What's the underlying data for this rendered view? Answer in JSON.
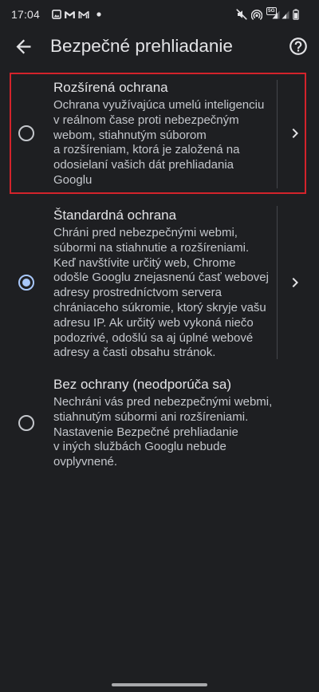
{
  "status_bar": {
    "time": "17:04",
    "network_type": "5G",
    "notification_icons": [
      "image-icon",
      "gmail-icon",
      "gmail-outline-icon",
      "dot-icon"
    ],
    "system_icons": [
      "mute-icon",
      "hotspot-icon",
      "signal-5g-icon",
      "signal-icon",
      "battery-icon"
    ]
  },
  "header": {
    "back_icon": "arrow-back-icon",
    "title": "Bezpečné prehliadanie",
    "help_icon": "help-icon"
  },
  "options": [
    {
      "title": "Rozšírená ochrana",
      "description": "Ochrana využívajúca umelú inteligenciu\nv reálnom čase proti nebezpečným\nwebom, stiahnutým súborom\na rozšíreniam, ktorá je založená na\nodosielaní vašich dát prehliadania\nGooglu",
      "selected": false,
      "details_icon": "chevron-right-icon"
    },
    {
      "title": "Štandardná ochrana",
      "description": "Chráni pred nebezpečnými webmi,\nsúbormi na stiahnutie a rozšíreniami.\nKeď navštívite určitý web, Chrome\nodošle Googlu znejasnenú časť webovej\nadresy prostredníctvom servera\nchrániaceho súkromie, ktorý skryje vašu\nadresu IP. Ak určitý web vykoná niečo\npodozrivé, odošlú sa aj úplné webové\nadresy a časti obsahu stránok.",
      "selected": true,
      "details_icon": "chevron-right-icon"
    },
    {
      "title": "Bez ochrany (neodporúča sa)",
      "description": "Nechráni vás pred nebezpečnými webmi,\nstiahnutým súbormi ani rozšíreniami.\nNastavenie Bezpečné prehliadanie\nv iných službách Googlu nebude\novplyvnené.",
      "selected": false
    }
  ],
  "colors": {
    "bg": "#1e1f22",
    "text_primary": "#e3e3e6",
    "text_secondary": "#c4c7cc",
    "accent": "#a8c7fa",
    "divider": "#44474c",
    "highlight": "#d3232b",
    "handle": "#a8a9ac"
  }
}
